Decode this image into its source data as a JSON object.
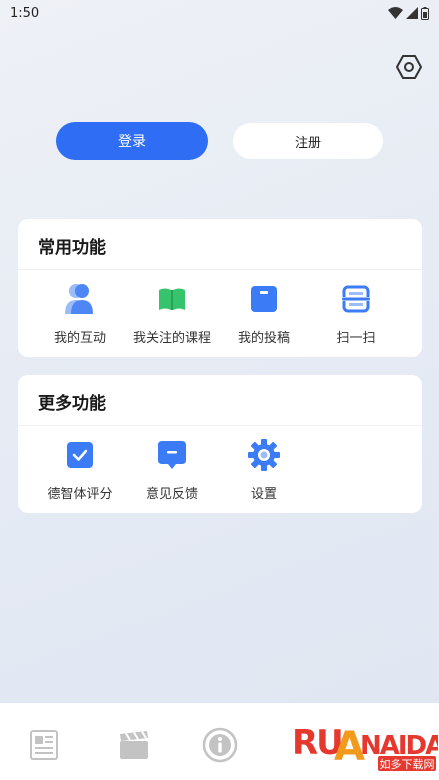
{
  "status": {
    "time": "1:50"
  },
  "icons": {
    "settings": "hexagon-settings-icon",
    "wifi": "wifi-icon",
    "signal": "signal-icon",
    "battery": "battery-icon"
  },
  "auth": {
    "login_label": "登录",
    "register_label": "注册"
  },
  "colors": {
    "primary": "#2f6df5",
    "green": "#35c46b",
    "background": "#e9edf4"
  },
  "common": {
    "title": "常用功能",
    "items": [
      {
        "label": "我的互动",
        "icon": "people-icon"
      },
      {
        "label": "我关注的课程",
        "icon": "book-icon"
      },
      {
        "label": "我的投稿",
        "icon": "document-icon"
      },
      {
        "label": "扫一扫",
        "icon": "scan-icon"
      }
    ]
  },
  "more": {
    "title": "更多功能",
    "items": [
      {
        "label": "德智体评分",
        "icon": "checkbox-icon"
      },
      {
        "label": "意见反馈",
        "icon": "message-icon"
      },
      {
        "label": "设置",
        "icon": "gear-icon"
      }
    ]
  },
  "bottom_nav": {
    "items": [
      {
        "icon": "newspaper-icon"
      },
      {
        "icon": "clapperboard-icon"
      },
      {
        "icon": "info-icon"
      }
    ]
  },
  "watermark": {
    "text": "RUANAIDAO",
    "subtitle": "如多下载网"
  }
}
